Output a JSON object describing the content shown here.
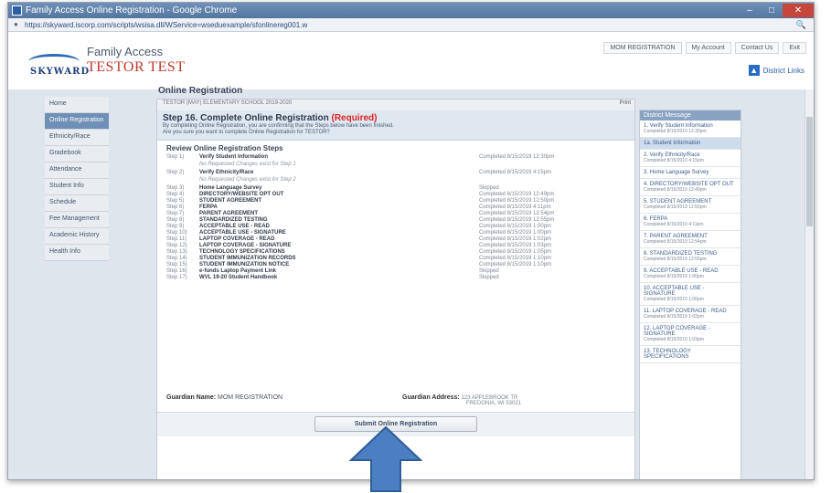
{
  "browser": {
    "window_title": "Family Access Online Registration - Google Chrome",
    "url": "https://skyward.iscorp.com/scripts/wsisa.dll/WService=wseduexample/sfonlinereg001.w",
    "win_buttons": [
      "–",
      "□",
      "✕"
    ]
  },
  "header": {
    "logo_word": "SKYWARD",
    "app_title": "Family Access",
    "student_name": "TESTOR TEST",
    "top_nav": [
      "MOM REGISTRATION",
      "My Account",
      "Contact Us",
      "Exit"
    ],
    "district_links": "District Links"
  },
  "sidebar": {
    "items": [
      {
        "label": "Home"
      },
      {
        "label": "Online Registration",
        "active": true
      },
      {
        "label": "Ethnicity/Race"
      },
      {
        "label": "Gradebook"
      },
      {
        "label": "Attendance"
      },
      {
        "label": "Student Info"
      },
      {
        "label": "Schedule"
      },
      {
        "label": "Fee Management"
      },
      {
        "label": "Academic History"
      },
      {
        "label": "Health Info"
      }
    ]
  },
  "main": {
    "page_title": "Online Registration",
    "school_line": "TESTOR (MAY) ELEMENTARY SCHOOL 2019-2020",
    "print_label": "Print",
    "step_title": "Step 16. Complete Online Registration",
    "required_label": "(Required)",
    "step_desc_1": "By completing Online Registration, you are confirming that the Steps below have been finished.",
    "step_desc_2": "Are you sure you want to complete Online Registration for TESTOR?",
    "review_title": "Review Online Registration Steps",
    "steps": [
      {
        "num": "Step 1)",
        "name": "Verify Student Information",
        "status": "Completed 8/15/2019 12:30pm",
        "note": "No Requested Changes exist for Step 1"
      },
      {
        "num": "Step 2)",
        "name": "Verify Ethnicity/Race",
        "status": "Completed 8/15/2019 4:15pm",
        "note": "No Requested Changes exist for Step 2"
      },
      {
        "num": "Step 3)",
        "name": "Home Language Survey",
        "status": "Skipped",
        "note": ""
      },
      {
        "num": "Step 4)",
        "name": "DIRECTORY/WEBSITE OPT OUT",
        "status": "Completed 8/15/2019 12:49pm",
        "note": ""
      },
      {
        "num": "Step 5)",
        "name": "STUDENT AGREEMENT",
        "status": "Completed 8/15/2019 12:50pm",
        "note": ""
      },
      {
        "num": "Step 6)",
        "name": "FERPA",
        "status": "Completed 8/15/2019 4:11pm",
        "note": ""
      },
      {
        "num": "Step 7)",
        "name": "PARENT AGREEMENT",
        "status": "Completed 8/15/2019 12:54pm",
        "note": ""
      },
      {
        "num": "Step 8)",
        "name": "STANDARDIZED TESTING",
        "status": "Completed 8/15/2019 12:55pm",
        "note": ""
      },
      {
        "num": "Step 9)",
        "name": "ACCEPTABLE USE - READ",
        "status": "Completed 8/15/2019 1:00pm",
        "note": ""
      },
      {
        "num": "Step 10)",
        "name": "ACCEPTABLE USE - SIGNATURE",
        "status": "Completed 8/15/2019 1:00pm",
        "note": ""
      },
      {
        "num": "Step 11)",
        "name": "LAPTOP COVERAGE - READ",
        "status": "Completed 8/15/2019 1:02pm",
        "note": ""
      },
      {
        "num": "Step 12)",
        "name": "LAPTOP COVERAGE - SIGNATURE",
        "status": "Completed 8/15/2019 1:03pm",
        "note": ""
      },
      {
        "num": "Step 13)",
        "name": "TECHNOLOGY SPECIFICATIONS",
        "status": "Completed 8/15/2019 1:05pm",
        "note": ""
      },
      {
        "num": "Step 14)",
        "name": "STUDENT IMMUNIZATION RECORDS",
        "status": "Completed 8/15/2019 1:10pm",
        "note": ""
      },
      {
        "num": "Step 15)",
        "name": "STUDENT IMMUNIZATION NOTICE",
        "status": "Completed 8/15/2019 1:10pm",
        "note": ""
      },
      {
        "num": "Step 16)",
        "name": "e-funds Laptop Payment Link",
        "status": "Skipped",
        "note": ""
      },
      {
        "num": "Step 17)",
        "name": "WVL 19-20 Student Handbook",
        "status": "Skipped",
        "note": ""
      }
    ],
    "guardian_name_label": "Guardian Name:",
    "guardian_name": "MOM REGISTRATION",
    "guardian_address_label": "Guardian Address:",
    "guardian_address_1": "123 APPLEBROOK TR",
    "guardian_address_2": "FREDONIA, WI 53021",
    "submit_label": "Submit Online Registration"
  },
  "rightcol": {
    "header": "District Message",
    "items": [
      {
        "label": "1. Verify Student Information",
        "status": "Completed 8/15/2019 12:30pm"
      },
      {
        "label": "1a. Student Information",
        "status": ""
      },
      {
        "label": "2. Verify Ethnicity/Race",
        "status": "Completed 8/15/2019 4:15pm"
      },
      {
        "label": "3. Home Language Survey",
        "status": ""
      },
      {
        "label": "4. DIRECTORY/WEBSITE OPT OUT",
        "status": "Completed 8/15/2019 12:49pm"
      },
      {
        "label": "5. STUDENT AGREEMENT",
        "status": "Completed 8/15/2019 12:50pm"
      },
      {
        "label": "6. FERPA",
        "status": "Completed 8/15/2019 4:11pm"
      },
      {
        "label": "7. PARENT AGREEMENT",
        "status": "Completed 8/15/2019 12:54pm"
      },
      {
        "label": "8. STANDARDIZED TESTING",
        "status": "Completed 8/15/2019 12:55pm"
      },
      {
        "label": "9. ACCEPTABLE USE - READ",
        "status": "Completed 8/15/2019 1:00pm"
      },
      {
        "label": "10. ACCEPTABLE USE - SIGNATURE",
        "status": "Completed 8/15/2019 1:00pm"
      },
      {
        "label": "11. LAPTOP COVERAGE - READ",
        "status": "Completed 8/15/2019 1:02pm"
      },
      {
        "label": "12. LAPTOP COVERAGE - SIGNATURE",
        "status": "Completed 8/15/2019 1:03pm"
      },
      {
        "label": "13. TECHNOLOGY SPECIFICATIONS",
        "status": ""
      }
    ]
  },
  "colors": {
    "accent": "#2e6db5",
    "required": "#d22222",
    "arrow": "#4a7fc1"
  }
}
